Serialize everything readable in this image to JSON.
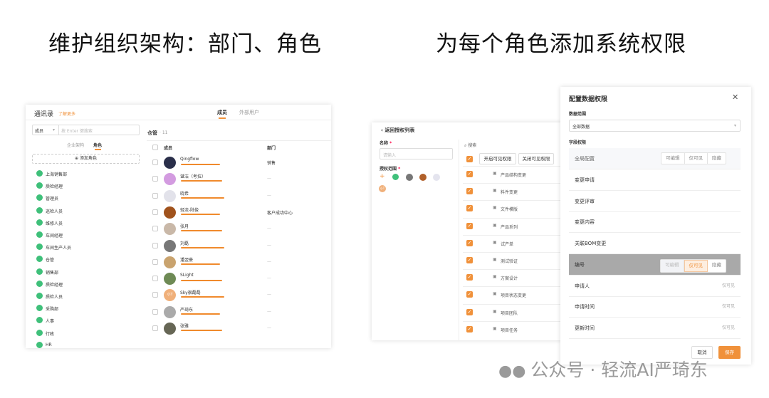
{
  "headings": {
    "left": "维护组织架构：部门、角色",
    "right": "为每个角色添加系统权限"
  },
  "contacts": {
    "title": "通讯录",
    "learn_more": "了解更多",
    "tabs": [
      "成员",
      "外部用户"
    ],
    "search": {
      "select": "成员",
      "placeholder": "按 Enter 键搜索"
    },
    "subtabs": [
      "企业架构",
      "角色"
    ],
    "add_role": "添加角色",
    "roles": [
      "上海销售部",
      "质检经理",
      "管理员",
      "巡检人员",
      "维修人员",
      "车间经理",
      "车间生产人员",
      "仓管",
      "销售部",
      "质检经理",
      "质检人员",
      "采购部",
      "人事",
      "行政",
      "HR"
    ],
    "group_title": "仓管",
    "group_count": "· 11",
    "columns": [
      "成员",
      "部门"
    ],
    "members": [
      {
        "name": "Qingflow",
        "dept": "销售"
      },
      {
        "name": "谌洁（考拉）",
        "dept": "—"
      },
      {
        "name": "晓希",
        "dept": "—"
      },
      {
        "name": "轻流-陆俊",
        "dept": "客户成功中心"
      },
      {
        "name": "张月",
        "dept": "—"
      },
      {
        "name": "刘磊",
        "dept": "—"
      },
      {
        "name": "潘翌豪",
        "dept": "—"
      },
      {
        "name": "SLight",
        "dept": "—"
      },
      {
        "name": "Sky很磊磊",
        "dept": "—"
      },
      {
        "name": "严琦东",
        "dept": "—"
      },
      {
        "name": "张雅",
        "dept": "—"
      }
    ],
    "avatar_text": "小T"
  },
  "auth": {
    "back": "返回授权列表",
    "name_label": "名称",
    "name_placeholder": "请输入",
    "scope_label": "授权范围",
    "required": "*",
    "scope_avatar_text": "小T",
    "search": "搜索",
    "enable_btn": "开启可见权限",
    "disable_btn": "关闭可见权限",
    "items": [
      "产品结构变更",
      "料件变更",
      "文件模版",
      "产品系列",
      "试产单",
      "测试验证",
      "方案设计",
      "项目状态变更",
      "项目团队",
      "项目任务"
    ]
  },
  "modal": {
    "title": "配置数据权限",
    "data_scope_label": "数据范围",
    "data_scope_value": "全部数据",
    "field_perm_label": "字段权限",
    "global": "全局配置",
    "options": [
      "可编辑",
      "仅可见",
      "隐藏"
    ],
    "fields": [
      {
        "name": "变更申请",
        "value": ""
      },
      {
        "name": "变更评审",
        "value": ""
      },
      {
        "name": "变更内容",
        "value": ""
      },
      {
        "name": "关联BOM变更",
        "value": ""
      },
      {
        "name": "编号",
        "value": "",
        "highlight": true
      },
      {
        "name": "申请人",
        "value": "仅可见"
      },
      {
        "name": "申请时间",
        "value": "仅可见"
      },
      {
        "name": "更新时间",
        "value": "仅可见"
      }
    ],
    "cancel": "取消",
    "save": "保存"
  },
  "watermark": "公众号 · 轻流AI严琦东",
  "colors": {
    "accent": "#f0913a",
    "green": "#3fc07a"
  }
}
